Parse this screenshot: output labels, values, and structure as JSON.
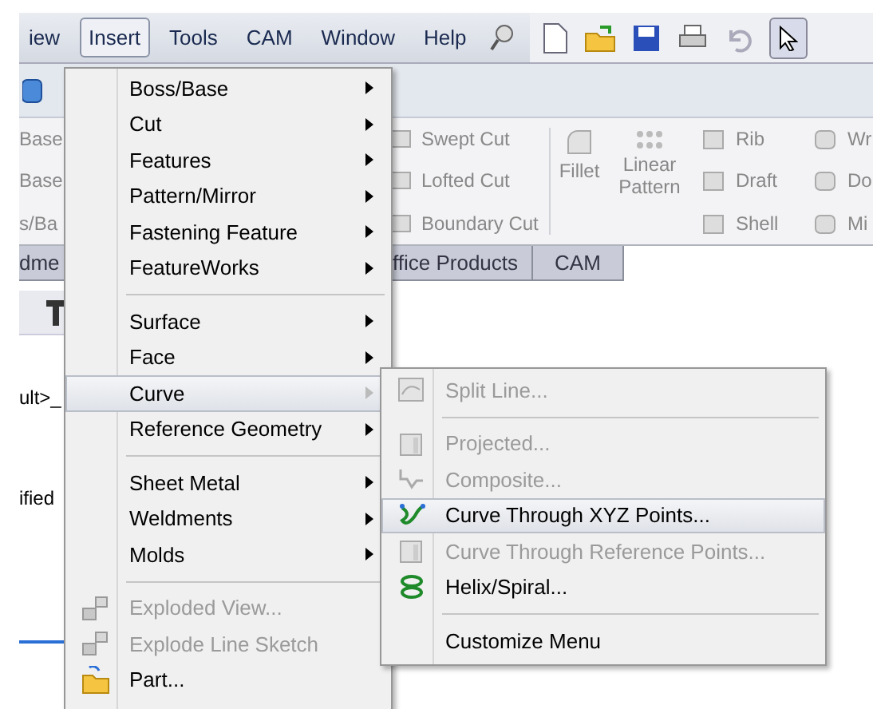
{
  "menu_bar": {
    "items": [
      {
        "label": "iew",
        "selected": false
      },
      {
        "label": "Insert",
        "selected": true
      },
      {
        "label": "Tools",
        "selected": false
      },
      {
        "label": "CAM",
        "selected": false
      },
      {
        "label": "Window",
        "selected": false
      },
      {
        "label": "Help",
        "selected": false
      }
    ]
  },
  "ribbon": {
    "left_labels": [
      "Base",
      "Base",
      "s/Ba"
    ],
    "cut_tools": [
      "Swept Cut",
      "Lofted Cut",
      "Boundary Cut"
    ],
    "fillet": "Fillet",
    "linear_pattern": "Linear Pattern",
    "tools": [
      "Rib",
      "Draft",
      "Shell"
    ],
    "right_labels": [
      "Wr",
      "Do",
      "Mi"
    ]
  },
  "tabs": [
    {
      "label": "dme",
      "selected": false
    },
    {
      "label": "ffice Products",
      "selected": false
    },
    {
      "label": "CAM",
      "selected": false
    }
  ],
  "left_panel": {
    "lines": [
      "ult>_",
      "ified"
    ]
  },
  "insert_menu": {
    "items": [
      {
        "kind": "item",
        "label": "Boss/Base",
        "submenu": true,
        "selected": false,
        "disabled": false
      },
      {
        "kind": "item",
        "label": "Cut",
        "submenu": true,
        "selected": false,
        "disabled": false
      },
      {
        "kind": "item",
        "label": "Features",
        "submenu": true,
        "selected": false,
        "disabled": false
      },
      {
        "kind": "item",
        "label": "Pattern/Mirror",
        "submenu": true,
        "selected": false,
        "disabled": false
      },
      {
        "kind": "item",
        "label": "Fastening Feature",
        "submenu": true,
        "selected": false,
        "disabled": false
      },
      {
        "kind": "item",
        "label": "FeatureWorks",
        "submenu": true,
        "selected": false,
        "disabled": false
      },
      {
        "kind": "separator"
      },
      {
        "kind": "item",
        "label": "Surface",
        "submenu": true,
        "selected": false,
        "disabled": false
      },
      {
        "kind": "item",
        "label": "Face",
        "submenu": true,
        "selected": false,
        "disabled": false
      },
      {
        "kind": "item",
        "label": "Curve",
        "submenu": true,
        "selected": true,
        "disabled": false
      },
      {
        "kind": "item",
        "label": "Reference Geometry",
        "submenu": true,
        "selected": false,
        "disabled": false
      },
      {
        "kind": "separator"
      },
      {
        "kind": "item",
        "label": "Sheet Metal",
        "submenu": true,
        "selected": false,
        "disabled": false
      },
      {
        "kind": "item",
        "label": "Weldments",
        "submenu": true,
        "selected": false,
        "disabled": false
      },
      {
        "kind": "item",
        "label": "Molds",
        "submenu": true,
        "selected": false,
        "disabled": false
      },
      {
        "kind": "separator"
      },
      {
        "kind": "item",
        "label": "Exploded View...",
        "submenu": false,
        "selected": false,
        "disabled": true
      },
      {
        "kind": "item",
        "label": "Explode Line Sketch",
        "submenu": false,
        "selected": false,
        "disabled": true
      },
      {
        "kind": "item",
        "label": "Part...",
        "submenu": false,
        "selected": false,
        "disabled": false
      }
    ]
  },
  "curve_submenu": {
    "items": [
      {
        "kind": "item",
        "label": "Split Line...",
        "selected": false,
        "disabled": true
      },
      {
        "kind": "separator"
      },
      {
        "kind": "item",
        "label": "Projected...",
        "selected": false,
        "disabled": true
      },
      {
        "kind": "item",
        "label": "Composite...",
        "selected": false,
        "disabled": true
      },
      {
        "kind": "item",
        "label": "Curve Through XYZ Points...",
        "selected": true,
        "disabled": false
      },
      {
        "kind": "item",
        "label": "Curve Through Reference Points...",
        "selected": false,
        "disabled": true
      },
      {
        "kind": "item",
        "label": "Helix/Spiral...",
        "selected": false,
        "disabled": false
      },
      {
        "kind": "separator"
      },
      {
        "kind": "item",
        "label": "Customize Menu",
        "selected": false,
        "disabled": false
      }
    ]
  }
}
